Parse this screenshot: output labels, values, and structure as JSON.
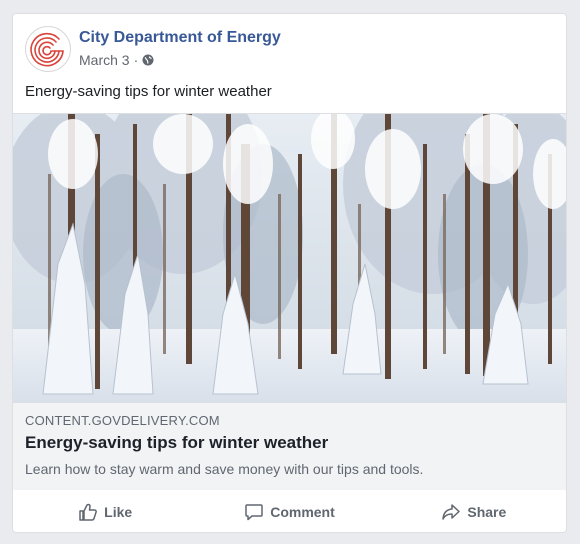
{
  "post": {
    "page_name": "City Department of Energy",
    "date": "March 3",
    "separator": "·",
    "privacy_icon": "globe-icon",
    "text": "Energy-saving tips for winter weather"
  },
  "link": {
    "image_icon": "snowy-forest-photo",
    "domain": "CONTENT.GOVDELIVERY.COM",
    "title": "Energy-saving tips for winter weather",
    "description": "Learn how to stay warm and save money with our tips and tools."
  },
  "actions": {
    "like_label": "Like",
    "comment_label": "Comment",
    "share_label": "Share"
  },
  "colors": {
    "page_name": "#385898",
    "logo_red": "#d9453d",
    "meta_gray": "#616770",
    "link_bg": "#f2f3f5"
  }
}
